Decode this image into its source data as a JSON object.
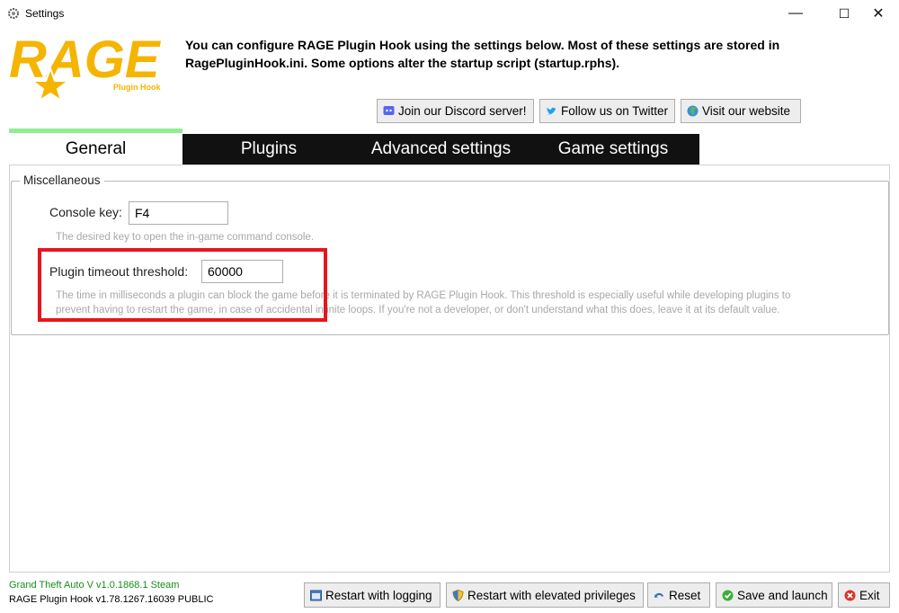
{
  "window": {
    "title": "Settings",
    "minimize_glyph": "—",
    "maximize_glyph": "☐",
    "close_glyph": "✕"
  },
  "logo": {
    "wordmark": "RAGE",
    "subtext": "Plugin Hook",
    "color": "#f5b400"
  },
  "intro": {
    "line1": "You can configure RAGE Plugin Hook using the settings below. Most of these settings are stored in",
    "line2": "RagePluginHook.ini. Some options alter the startup script (startup.rphs)."
  },
  "social": {
    "discord_label": "Join our Discord server!",
    "twitter_label": "Follow us on Twitter",
    "website_label": "Visit our website",
    "icons": [
      "discord-icon",
      "twitter-icon",
      "globe-icon"
    ]
  },
  "tabs": [
    {
      "label": "General",
      "active": true
    },
    {
      "label": "Plugins",
      "active": false
    },
    {
      "label": "Advanced settings",
      "active": false
    },
    {
      "label": "Game settings",
      "active": false
    }
  ],
  "general": {
    "group_title": "Miscellaneous",
    "console_key": {
      "label": "Console key:",
      "value": "F4",
      "hint": "The desired key to open the in-game command console."
    },
    "plugin_timeout": {
      "label": "Plugin timeout threshold:",
      "value": "60000",
      "hint_line1": "The time in milliseconds a plugin can block the game before it is terminated by RAGE Plugin Hook. This threshold is especially useful while developing plugins to",
      "hint_line2": "prevent having to restart the game, in case of accidental infinite loops. If you're not a developer, or don't understand what this does, leave it at its default value."
    }
  },
  "footer": {
    "game_version": "Grand Theft Auto V v1.0.1868.1 Steam",
    "rph_version": "RAGE Plugin Hook v1.78.1267.16039 PUBLIC",
    "buttons": {
      "restart_logging": "Restart with logging",
      "restart_elevated": "Restart with elevated privileges",
      "reset": "Reset",
      "save_launch": "Save and launch",
      "exit": "Exit"
    }
  },
  "colors": {
    "accent_tab": "#90ee90",
    "highlight_box": "#e8141d",
    "tab_inactive_bg": "#111111",
    "version_green": "#1a8c1a"
  }
}
